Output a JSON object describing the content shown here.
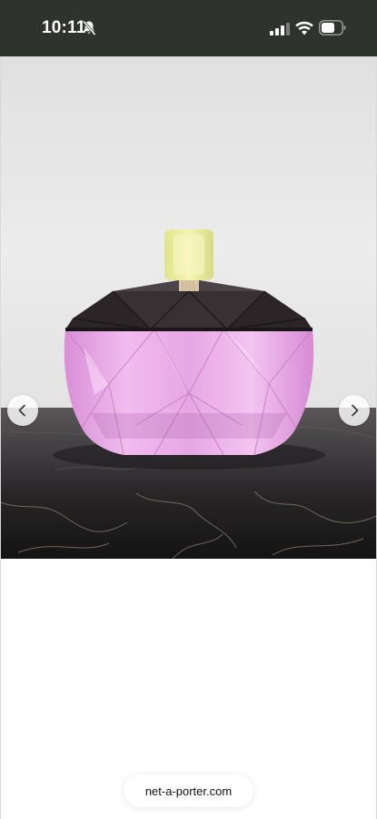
{
  "status_bar": {
    "time": "10:11",
    "icons": [
      "bell-slash-icon",
      "cellular-signal-icon",
      "wifi-icon",
      "battery-icon"
    ],
    "background": "#2f332e"
  },
  "product_image": {
    "subject": "faceted pink crystal jar with black lid and yellow knob on marble surface",
    "colors": {
      "crystal": "#e9a9e6",
      "lid": "#2b2427",
      "knob": "#ecec9c",
      "backdrop": "#e8e8e8",
      "marble": "#262427"
    }
  },
  "carousel": {
    "prev_icon": "chevron-left-icon",
    "next_icon": "chevron-right-icon"
  },
  "browser": {
    "url": "net-a-porter.com"
  }
}
